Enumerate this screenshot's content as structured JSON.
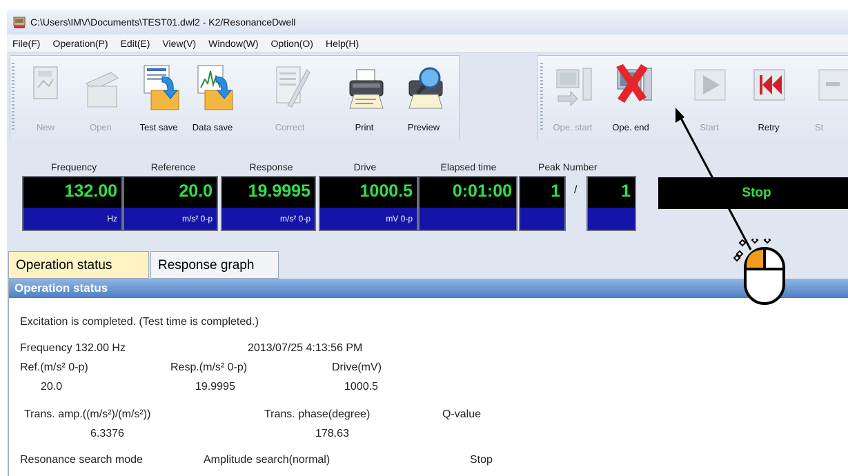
{
  "window": {
    "title": "C:\\Users\\IMV\\Documents\\TEST01.dwl2 - K2/ResonanceDwell"
  },
  "menu": [
    "File(F)",
    "Operation(P)",
    "Edit(E)",
    "View(V)",
    "Window(W)",
    "Option(O)",
    "Help(H)"
  ],
  "toolbar1": [
    {
      "label": "New",
      "enabled": false
    },
    {
      "label": "Open",
      "enabled": false
    },
    {
      "label": "Test save",
      "enabled": true
    },
    {
      "label": "Data save",
      "enabled": true
    },
    {
      "label": "Correct",
      "enabled": false
    },
    {
      "label": "Print",
      "enabled": true
    },
    {
      "label": "Preview",
      "enabled": true
    }
  ],
  "toolbar2": [
    {
      "label": "Ope. start",
      "enabled": false
    },
    {
      "label": "Ope. end",
      "enabled": true
    },
    {
      "label": "Start",
      "enabled": false
    },
    {
      "label": "Retry",
      "enabled": true
    },
    {
      "label": "St",
      "enabled": false
    }
  ],
  "monitor": {
    "frequency": {
      "label": "Frequency",
      "value": "132.00",
      "unit": "Hz"
    },
    "reference": {
      "label": "Reference",
      "value": "20.0",
      "unit": "m/s² 0-p"
    },
    "response": {
      "label": "Response",
      "value": "19.9995",
      "unit": "m/s² 0-p"
    },
    "drive": {
      "label": "Drive",
      "value": "1000.5",
      "unit": "mV 0-p"
    },
    "elapsed": {
      "label": "Elapsed time",
      "value": "0:01:00",
      "unit": ""
    },
    "peak": {
      "label": "Peak Number",
      "current": "1",
      "separator": "/",
      "total": "1"
    },
    "status": "Stop"
  },
  "tabs": [
    "Operation status",
    "Response graph"
  ],
  "status_panel": {
    "header": "Operation status",
    "completed_msg": "Excitation is completed. (Test time is completed.)",
    "frequency_line": "Frequency 132.00 Hz",
    "timestamp": "2013/07/25 4:13:56 PM",
    "ref_label": "Ref.(m/s² 0-p)",
    "resp_label": "Resp.(m/s² 0-p)",
    "drive_label": "Drive(mV)",
    "ref_value": "20.0",
    "resp_value": "19.9995",
    "drive_value": "1000.5",
    "trans_amp_label": "Trans. amp.((m/s²)/(m/s²))",
    "trans_phase_label": "Trans. phase(degree)",
    "q_label": "Q-value",
    "trans_amp_value": "6.3376",
    "trans_phase_value": "178.63",
    "search_mode_label": "Resonance search mode",
    "search_mode_value": "Amplitude search(normal)",
    "search_state": "Stop"
  },
  "colors": {
    "digit": "#2fe04a",
    "unit_bg": "#1414a8",
    "accent_tab": "#fff3c4",
    "mouse_highlight": "#f39a1f"
  }
}
